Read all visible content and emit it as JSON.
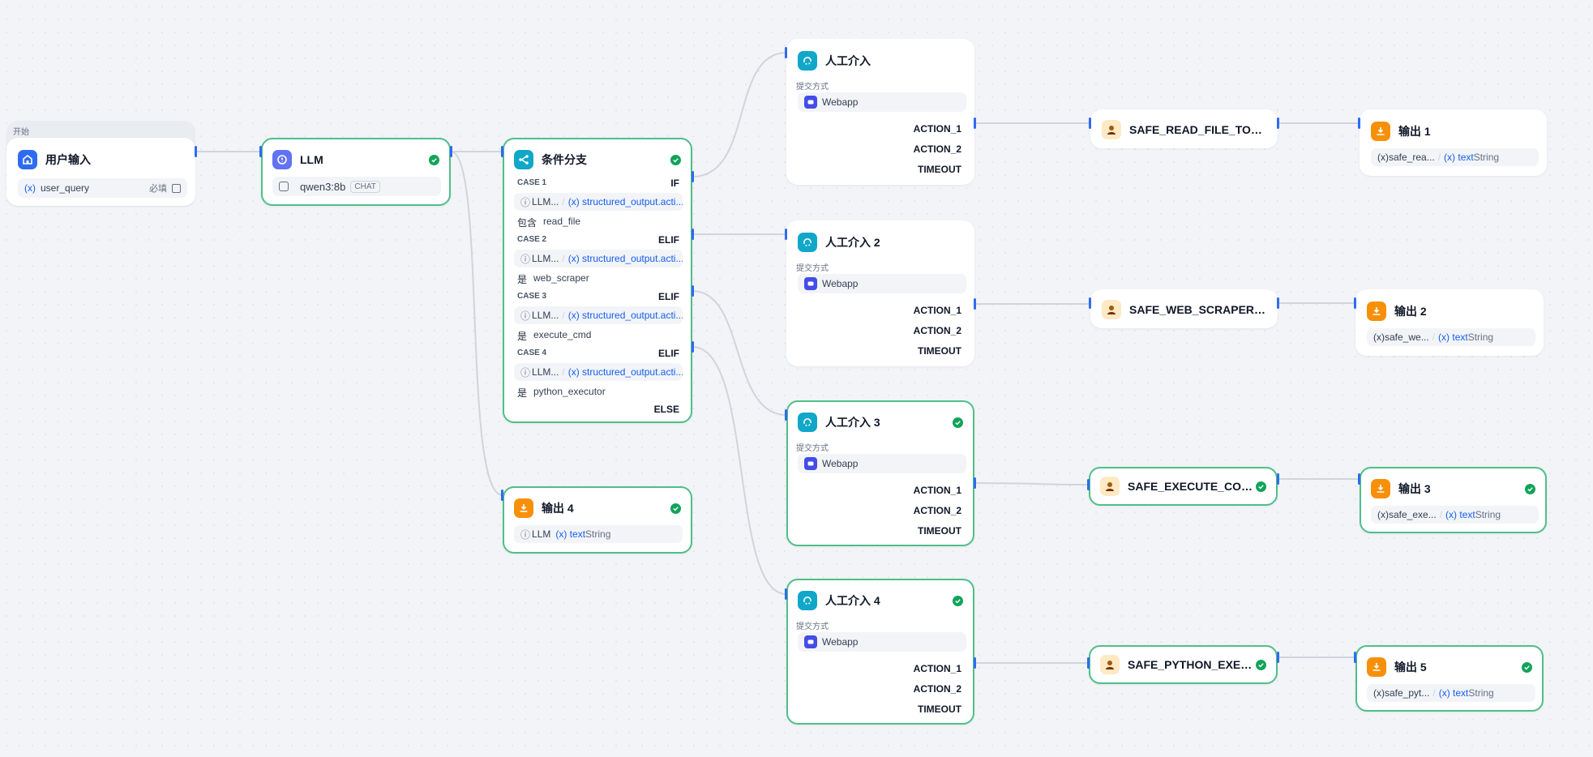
{
  "start_group": {
    "label": "开始"
  },
  "nodes": {
    "user_input": {
      "title": "用户输入",
      "var_icon": "(x)",
      "var_name": "user_query",
      "required": "必填"
    },
    "llm": {
      "title": "LLM",
      "model": "qwen3:8b",
      "tag": "CHAT"
    },
    "branch": {
      "title": "条件分支",
      "cases": [
        {
          "label": "CASE 1",
          "kw": "IF",
          "src": "LLM...",
          "var": "(x) structured_output.acti...",
          "op": "包含",
          "value": "read_file"
        },
        {
          "label": "CASE 2",
          "kw": "ELIF",
          "src": "LLM...",
          "var": "(x) structured_output.acti...",
          "op": "是",
          "value": "web_scraper"
        },
        {
          "label": "CASE 3",
          "kw": "ELIF",
          "src": "LLM...",
          "var": "(x) structured_output.acti...",
          "op": "是",
          "value": "execute_cmd"
        },
        {
          "label": "CASE 4",
          "kw": "ELIF",
          "src": "LLM...",
          "var": "(x) structured_output.acti...",
          "op": "是",
          "value": "python_executor"
        }
      ],
      "else_label": "ELSE"
    },
    "output4": {
      "title": "输出 4",
      "src": "LLM",
      "var": "(x) text",
      "type": "String"
    },
    "human": [
      {
        "title": "人工介入",
        "submit_label": "提交方式",
        "method": "Webapp",
        "actions": [
          "ACTION_1",
          "ACTION_2",
          "TIMEOUT"
        ]
      },
      {
        "title": "人工介入 2",
        "submit_label": "提交方式",
        "method": "Webapp",
        "actions": [
          "ACTION_1",
          "ACTION_2",
          "TIMEOUT"
        ]
      },
      {
        "title": "人工介入 3",
        "submit_label": "提交方式",
        "method": "Webapp",
        "actions": [
          "ACTION_1",
          "ACTION_2",
          "TIMEOUT"
        ]
      },
      {
        "title": "人工介入 4",
        "submit_label": "提交方式",
        "method": "Webapp",
        "actions": [
          "ACTION_1",
          "ACTION_2",
          "TIMEOUT"
        ]
      }
    ],
    "tools": [
      {
        "title": "SAFE_READ_FILE_TOOL_R..."
      },
      {
        "title": "SAFE_WEB_SCRAPER_TO..."
      },
      {
        "title": "SAFE_EXECUTE_COMM..."
      },
      {
        "title": "SAFE_PYTHON_EXECU..."
      }
    ],
    "outputs": [
      {
        "title": "输出 1",
        "src": "(x)safe_rea...",
        "var": "(x) text",
        "type": "String"
      },
      {
        "title": "输出 2",
        "src": "(x)safe_we...",
        "var": "(x) text",
        "type": "String"
      },
      {
        "title": "输出 3",
        "src": "(x)safe_exe...",
        "var": "(x) text",
        "type": "String"
      },
      {
        "title": "输出 5",
        "src": "(x)safe_pyt...",
        "var": "(x) text",
        "type": "String"
      }
    ]
  },
  "colors": {
    "selected_border": "#4fbf8a",
    "edge": "#d0d5dd",
    "handle": "#2e6bf0"
  },
  "icons": {
    "start": "home-icon",
    "llm": "llm-icon",
    "branch": "branch-icon",
    "human": "human-input-icon",
    "tool": "tool-avatar-icon",
    "output": "output-icon",
    "done": "check-icon"
  }
}
